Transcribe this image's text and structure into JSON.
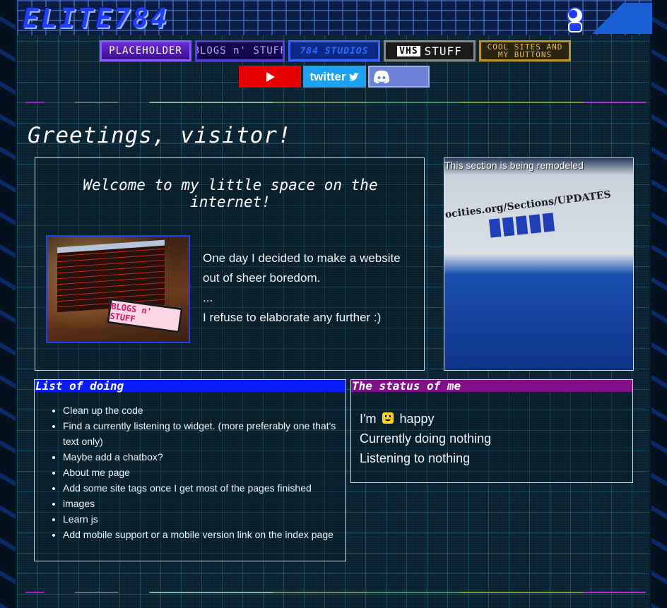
{
  "header": {
    "logo": "ELITE784"
  },
  "nav": {
    "placeholder": "PLACEHOLDER",
    "blogs": "BLOGS n' STUFF",
    "studios": "784 STUDIOS",
    "vhs_badge": "VHS",
    "vhs": "STUFF",
    "cool": "COOL SITES AND MY BUTTONS"
  },
  "social": {
    "twitter": "twitter"
  },
  "greeting": "Greetings, visitor!",
  "welcome": {
    "title": "Welcome to my little space on the internet!",
    "photo_sign": "BLOGS n' STUFF",
    "line1": "One day I decided to make a website out of sheer boredom.",
    "line2": "...",
    "line3": "I refuse to elaborate any further :)"
  },
  "remodel": {
    "label": "This section is being remodeled",
    "url": "ocities.org/Sections/UPDATES"
  },
  "todo": {
    "title": "List of doing",
    "items": [
      "Clean up the code",
      "Find a currently listening to widget. (more preferably one that's text only)",
      "Maybe add a chatbox?",
      "About me page",
      "Add some site tags once I get most of the pages finished",
      "images",
      "Learn js",
      "Add mobile support or a mobile version link on the index page"
    ]
  },
  "status": {
    "title": "The status of me",
    "im": "I'm",
    "mood": "happy",
    "doing": "Currently doing nothing",
    "listening": "Listening to nothing"
  }
}
